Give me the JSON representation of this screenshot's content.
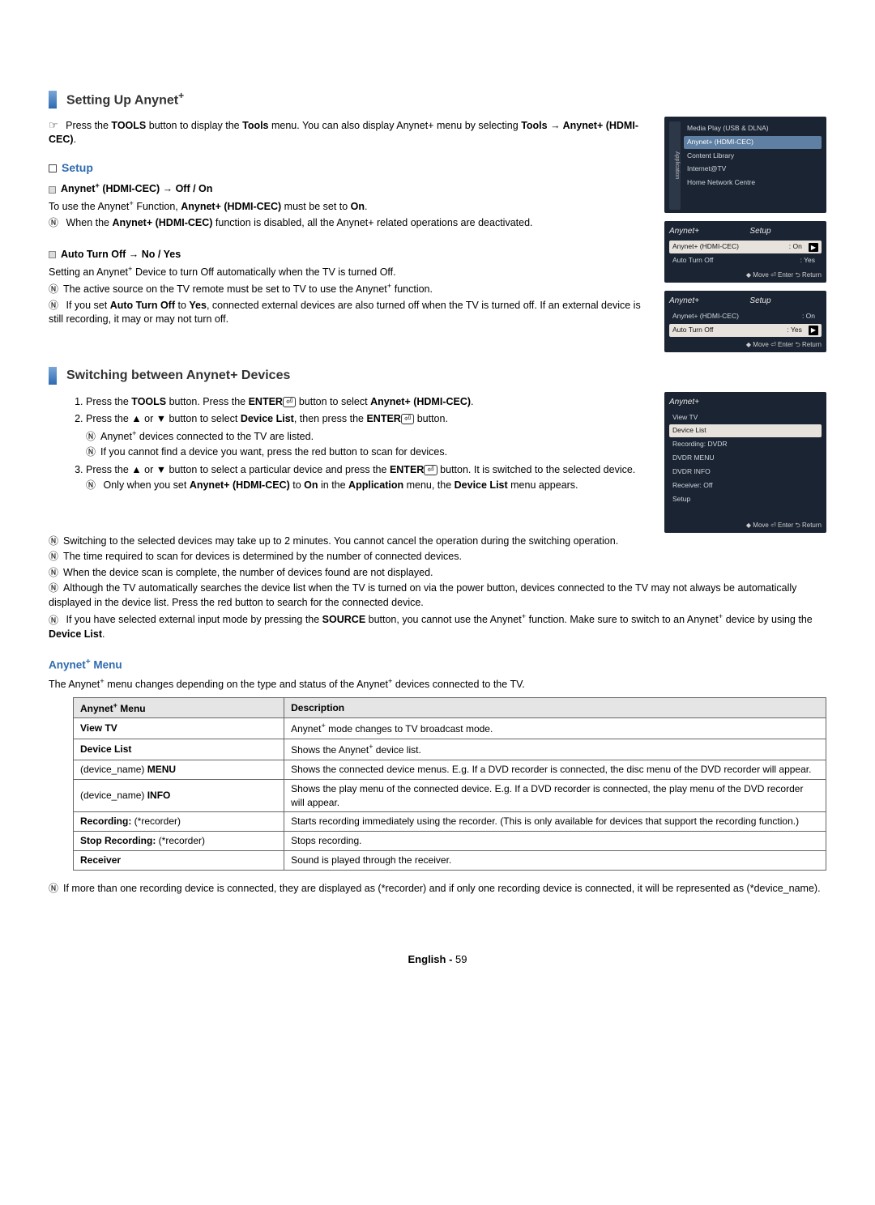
{
  "section1": {
    "heading": "Setting Up Anynet",
    "intro_part1": "Press the ",
    "intro_bold1": "TOOLS",
    "intro_part2": " button to display the ",
    "intro_bold2": "Tools",
    "intro_part3": " menu. You can also display Anynet+ menu by selecting ",
    "intro_bold3": "Tools → Anynet+ (HDMI-CEC)",
    "intro_part4": ".",
    "setup_sub": "Setup",
    "opt1_label": "Anynet+ (HDMI-CEC) → Off / On",
    "opt1_line1_a": "To use the Anynet",
    "opt1_line1_b": " Function, ",
    "opt1_line1_bold": "Anynet+ (HDMI-CEC)",
    "opt1_line1_c": " must be set to ",
    "opt1_line1_on": "On",
    "opt1_line1_d": ".",
    "opt1_note_a": "When the ",
    "opt1_note_bold": "Anynet+ (HDMI-CEC)",
    "opt1_note_b": " function is disabled, all the Anynet+ related operations are deactivated.",
    "opt2_label": "Auto Turn Off → No / Yes",
    "opt2_line": "Setting an Anynet+ Device to turn Off automatically when the TV is turned Off.",
    "opt2_note1": "The active source on the TV remote must be set to TV to use the Anynet+ function.",
    "opt2_note2_a": "If you set ",
    "opt2_note2_bold1": "Auto Turn Off",
    "opt2_note2_b": " to ",
    "opt2_note2_bold2": "Yes",
    "opt2_note2_c": ", connected external devices are also turned off when the TV is turned off. If an external device is still recording, it may or may not turn off."
  },
  "osd_app": {
    "sidebar": "Application",
    "items": [
      "Media Play (USB & DLNA)",
      "Anynet+ (HDMI-CEC)",
      "Content Library",
      "Internet@TV",
      "Home Network Centre"
    ]
  },
  "osd_setup": {
    "title": "Setup",
    "brand": "Anynet+",
    "row1_label": "Anynet+ (HDMI-CEC)",
    "row1_val": ": On",
    "row2_label": "Auto Turn Off",
    "row2_val": ": Yes",
    "foot": "◆ Move   ⏎ Enter   ⮌ Return"
  },
  "osd_device": {
    "brand": "Anynet+",
    "items": [
      "View TV",
      "Device List",
      "Recording: DVDR",
      "DVDR MENU",
      "DVDR INFO",
      "Receiver: Off",
      "Setup"
    ],
    "foot": "◆ Move   ⏎ Enter   ⮌ Return"
  },
  "section2": {
    "heading": "Switching between Anynet+ Devices",
    "step1_a": "Press the ",
    "step1_b1": "TOOLS",
    "step1_c": " button. Press the ",
    "step1_b2": "ENTER",
    "step1_d": " button to select ",
    "step1_b3": "Anynet+ (HDMI-CEC)",
    "step1_e": ".",
    "step2_a": "Press the ▲ or ▼ button to select ",
    "step2_b1": "Device List",
    "step2_b": ", then press the ",
    "step2_b2": "ENTER",
    "step2_c": " button.",
    "step2_note1": "Anynet+ devices connected to the TV are listed.",
    "step2_note2": "If you cannot find a device you want, press the red button to scan for devices.",
    "step3_a": "Press the ▲ or ▼ button to select a particular device and press the ",
    "step3_b1": "ENTER",
    "step3_b": " button. It is switched to the selected device.",
    "step3_note_a": "Only when you set ",
    "step3_note_b1": "Anynet+ (HDMI-CEC)",
    "step3_note_b": " to ",
    "step3_note_on": "On",
    "step3_note_c": " in the ",
    "step3_note_app": "Application",
    "step3_note_d": " menu, the ",
    "step3_note_dl": "Device List",
    "step3_note_e": " menu appears.",
    "notes": [
      "Switching to the selected devices may take up to 2 minutes. You cannot cancel the operation during the switching operation.",
      "The time required to scan for devices is determined by the number of connected devices.",
      "When the device scan is complete, the number of devices found are not displayed.",
      "Although the TV automatically searches the device list when the TV is turned on via the power button, devices connected to the TV may not always be automatically displayed in the device list. Press the red button to search for the connected device."
    ],
    "note_src_a": "If you have selected external input mode by pressing the ",
    "note_src_b1": "SOURCE",
    "note_src_b": " button, you cannot use the Anynet",
    "note_src_c": " function. Make sure to switch to an Anynet",
    "note_src_d": " device by using the ",
    "note_src_dl": "Device List",
    "note_src_e": "."
  },
  "menu": {
    "heading": "Anynet+ Menu",
    "intro": "The Anynet+ menu changes depending on the type and status of the Anynet+ devices connected to the TV.",
    "th1": "Anynet+ Menu",
    "th2": "Description",
    "rows": [
      {
        "c1": "View TV",
        "c2": "Anynet+ mode changes to TV broadcast mode."
      },
      {
        "c1": "Device List",
        "c2": "Shows the Anynet+ device list."
      },
      {
        "c1": "(device_name) MENU",
        "c2": "Shows the connected device menus. E.g. If a DVD recorder is connected, the disc menu of the DVD recorder will appear."
      },
      {
        "c1": "(device_name) INFO",
        "c2": "Shows the play menu of the connected device. E.g. If a DVD recorder is connected, the play menu of the DVD recorder will appear."
      },
      {
        "c1": "Recording: (*recorder)",
        "c2": "Starts recording immediately using the recorder. (This is only available for devices that support the recording function.)"
      },
      {
        "c1": "Stop Recording: (*recorder)",
        "c2": "Stops recording."
      },
      {
        "c1": "Receiver",
        "c2": "Sound is played through the receiver."
      }
    ],
    "footnote": "If more than one recording device is connected, they are displayed as (*recorder) and if only one recording device is connected, it will be represented as (*device_name)."
  },
  "footer": {
    "lang": "English - ",
    "page": "59"
  }
}
